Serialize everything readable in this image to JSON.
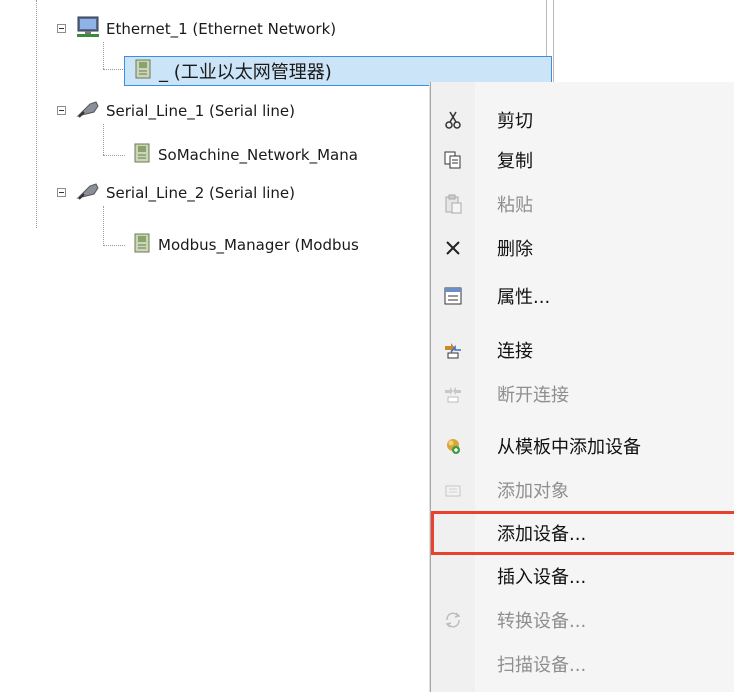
{
  "tree": {
    "nodes": [
      {
        "id": "ethernet",
        "label": "Ethernet_1 (Ethernet Network)",
        "icon": "ethernet-network-icon"
      },
      {
        "id": "eth-manager",
        "label": "_ (工业以太网管理器)",
        "icon": "device-module-icon",
        "selected": true
      },
      {
        "id": "serial1",
        "label": "Serial_Line_1 (Serial line)",
        "icon": "serial-cable-icon"
      },
      {
        "id": "somachine",
        "label": "SoMachine_Network_Mana",
        "icon": "device-module-icon"
      },
      {
        "id": "serial2",
        "label": "Serial_Line_2 (Serial line)",
        "icon": "serial-cable-icon"
      },
      {
        "id": "modbus",
        "label": "Modbus_Manager (Modbus",
        "icon": "device-module-icon"
      }
    ]
  },
  "context_menu": {
    "items": [
      {
        "label": "剪切",
        "icon": "scissors-icon",
        "disabled": false
      },
      {
        "label": "复制",
        "icon": "copy-icon",
        "disabled": false
      },
      {
        "label": "粘贴",
        "icon": "paste-icon",
        "disabled": true
      },
      {
        "label": "删除",
        "icon": "delete-x-icon",
        "disabled": false
      },
      {
        "label": "属性...",
        "icon": "properties-icon",
        "disabled": false
      },
      {
        "label": "连接",
        "icon": "connect-icon",
        "disabled": false
      },
      {
        "label": "断开连接",
        "icon": "disconnect-icon",
        "disabled": true
      },
      {
        "label": "从模板中添加设备",
        "icon": "add-from-template-icon",
        "disabled": false
      },
      {
        "label": "添加对象",
        "icon": "add-object-icon",
        "disabled": true
      },
      {
        "label": "添加设备...",
        "icon": "",
        "disabled": false,
        "highlighted": true
      },
      {
        "label": "插入设备...",
        "icon": "",
        "disabled": false
      },
      {
        "label": "转换设备...",
        "icon": "convert-icon",
        "disabled": true
      },
      {
        "label": "扫描设备...",
        "icon": "",
        "disabled": true
      }
    ]
  },
  "colors": {
    "selection_fill": "#cce4f7",
    "selection_border": "#3a8ee6",
    "highlight_outline": "#e8412c",
    "disabled_text": "#8f8f8f"
  }
}
